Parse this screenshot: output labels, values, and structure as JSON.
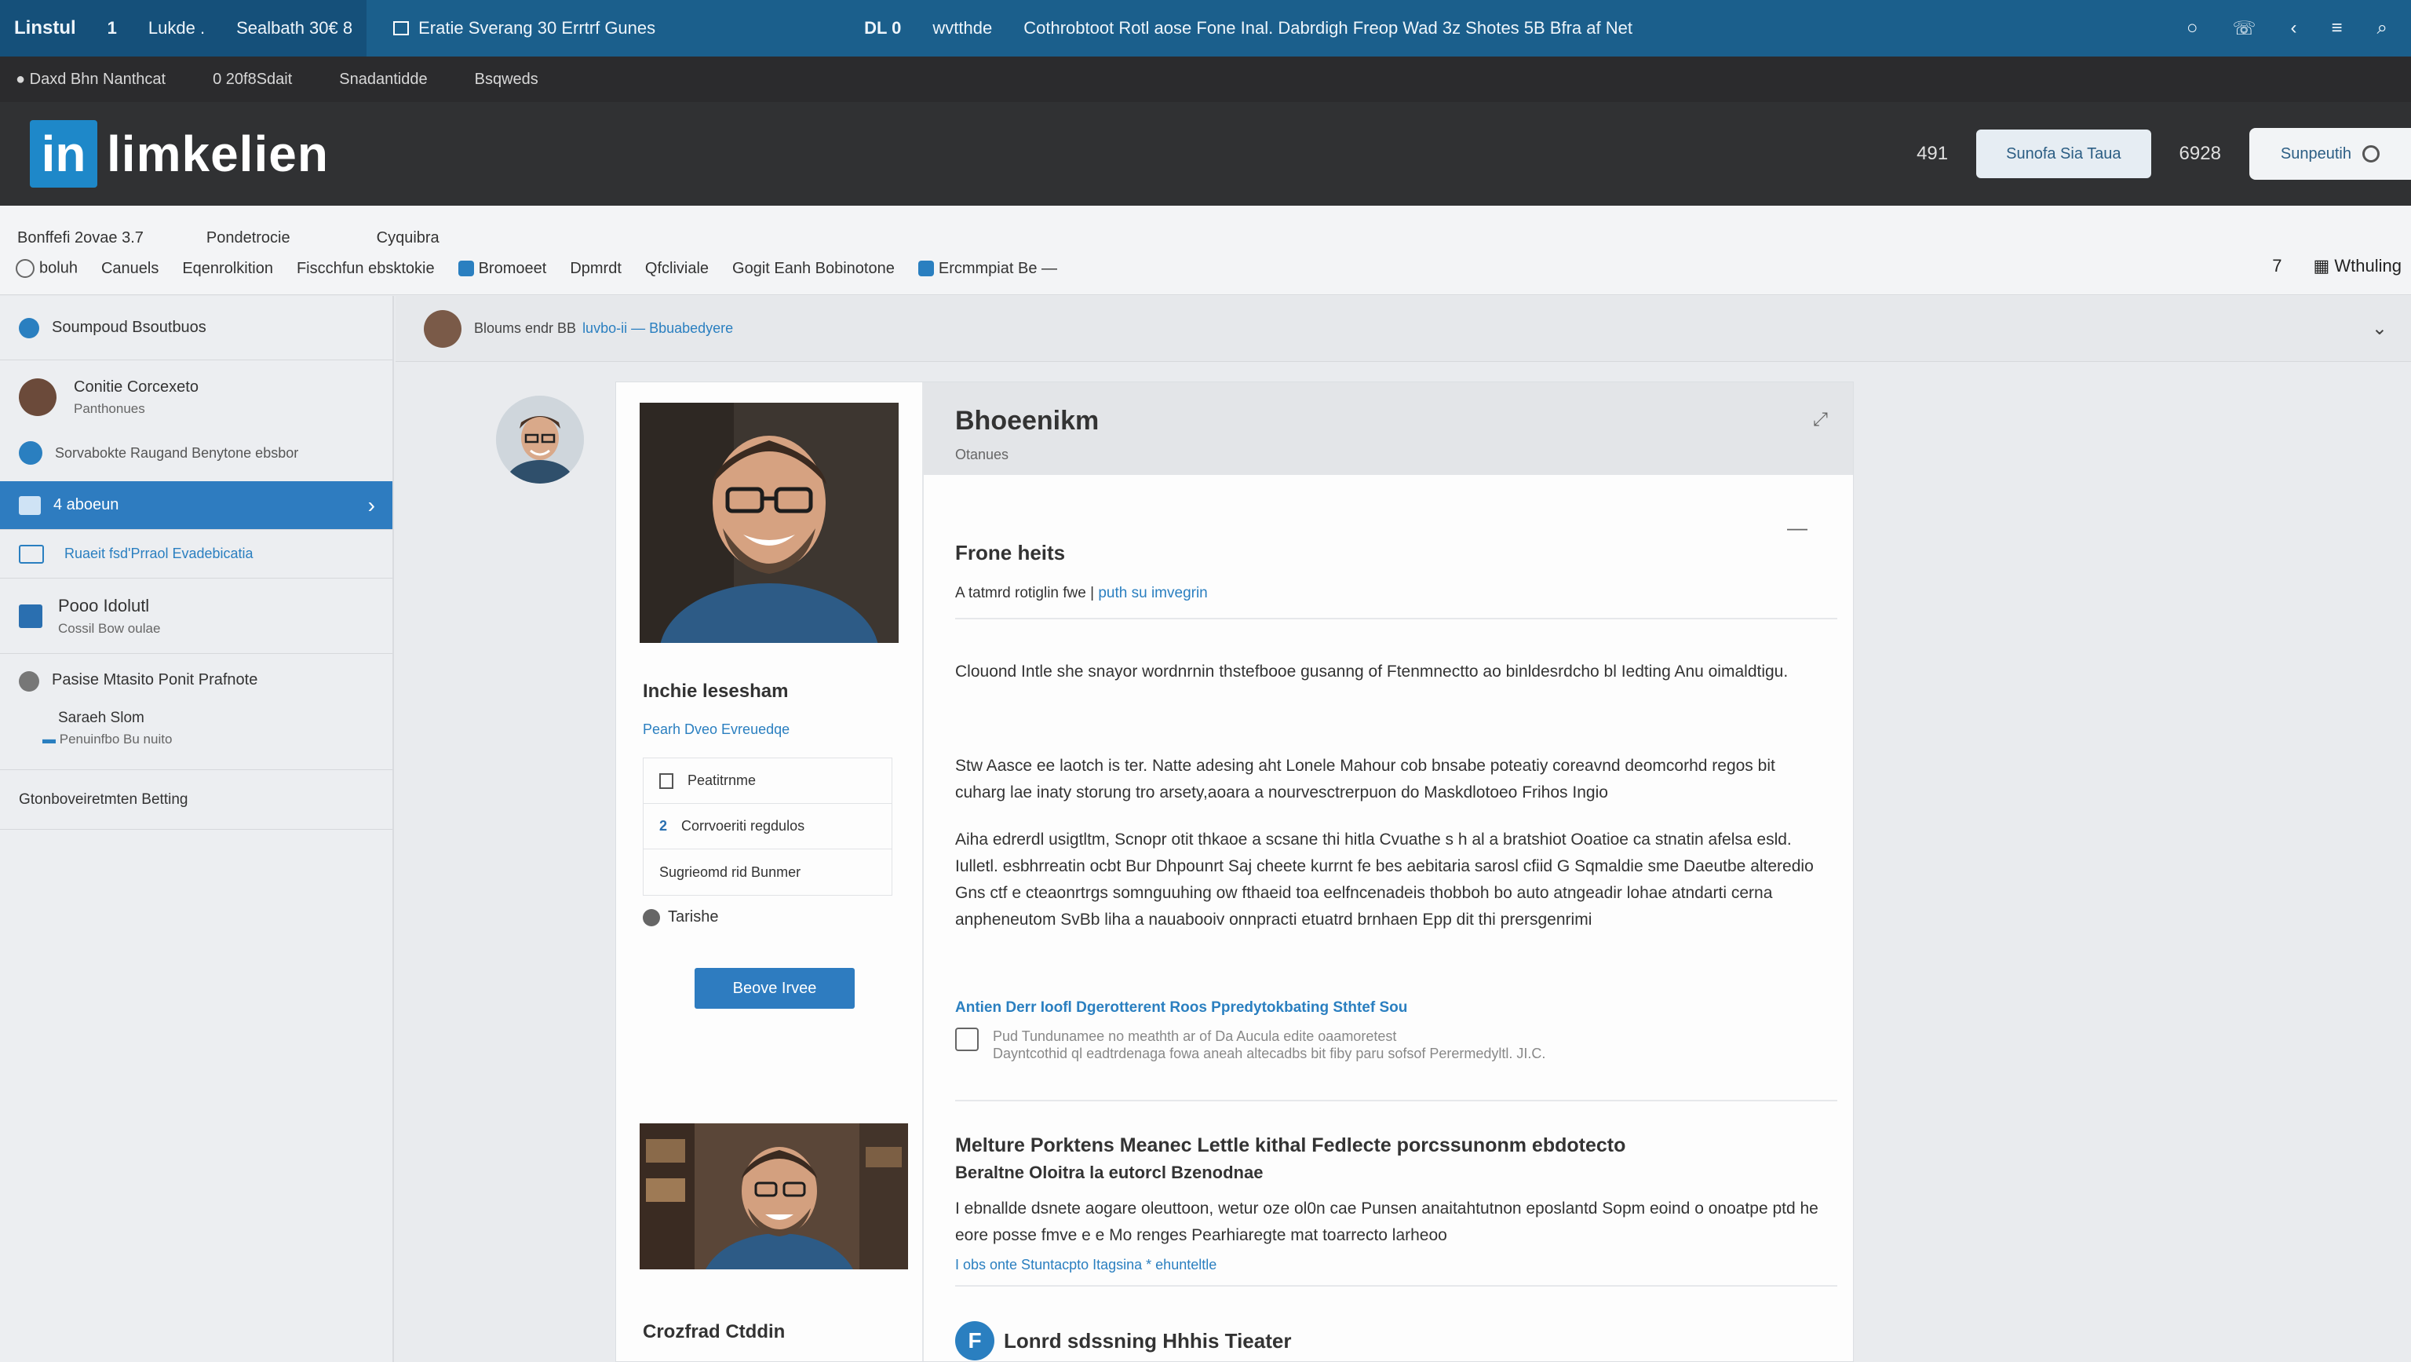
{
  "topbar": {
    "brand": "Linstul",
    "count": "1",
    "tab1": "Lukde .",
    "tab2": "Sealbath 30€ 8",
    "tab3": "Eratie Sverang  30 Errtrf Gunes",
    "center1": "DL 0",
    "center2": "wvtthde",
    "center3": "Cothrobtoot Rotl aose  Fone Inal. Dabrdigh Freop Wad 3z Shotes 5B Bfra af Net"
  },
  "subbar": {
    "item1": "Daxd Bhn Nanthcat",
    "item2": "0  20f8Sdait",
    "item3": "Snadantidde",
    "item4": "Bsqweds"
  },
  "header": {
    "logo_letter": "in",
    "logo_text": "limkelien",
    "count1": "491",
    "button1": "Sunofa Sia Taua",
    "count2": "6928",
    "button2": "Sunpeutih"
  },
  "nav": {
    "r1_item1": "Bonffefi 2ovae  3.7",
    "r1_item2": "Pondetrocie",
    "r1_item3": "Cyquibra",
    "r2_items": [
      "boluh",
      "Canuels",
      "Eqenrolkition",
      "Fiscchfun ebsktokie",
      "Bromoeet",
      "Dpmrdt",
      "Qfcliviale",
      "Gogit Eanh Bobinotone",
      "Ercmmpiat Be"
    ],
    "right_count": "7",
    "right_label": "Wthuling"
  },
  "sidebar": {
    "header": "Soumpoud Bsoutbuos",
    "item1_title": "Conitie Corcexeto",
    "item1_sub": "Panthonues",
    "item2": "Sorvabokte Raugand Benytone ebsbor",
    "active": "4 aboeun",
    "link": "Ruaeit fsd'Prraol Evadebicatia",
    "item4_title": "Pooo Idolutl",
    "item4_sub": "Cossil Bow oulae",
    "item5_title": "Pasise Mtasito Ponit Prafnote",
    "item5_sub1": "Saraeh Slom",
    "item5_sub2": "Penuinfbo Bu nuito",
    "item6": "Gtonboveiretmten Betting"
  },
  "main": {
    "header_text": "Bloums endr BB",
    "header_link": "luvbo-ii — Bbuabedyere",
    "left": {
      "name": "Inchie lesesham",
      "link": "Pearh Dveo Evreuedqe",
      "list": [
        "Peatitrnme",
        "Corrvoeriti regdulos",
        "Sugrieomd rid Bunmer"
      ],
      "list_num": "2",
      "tag": "Tarishe",
      "button": "Beove Irvee",
      "bottom": "Crozfrad Ctddin"
    },
    "right": {
      "title": "Bhoeenikm",
      "subtitle": "Otanues",
      "section": "Frone heits",
      "tag_prefix": "A tatmrd rotiglin fwe |",
      "tag_link": "puth su imvegrin",
      "p1": "Clouond Intle she snayor wordnrnin thstefbooe gusanng of Ftenmnectto ao binldesrdcho bl Iedting Anu oimaldtigu.",
      "p2": "Stw Aasce ee laotch is ter. Natte adesing aht Lonele Mahour cob bnsabe poteatiy coreavnd deomcorhd regos bit cuharg lae inaty storung tro arsety,aoara a nourvesctrerpuon do Maskdlotoeo Frihos Ingio",
      "p3": "Aiha edrerdl usigtltm, Scnopr otit thkaoe a scsane thi hitla Cvuathe s h al a bratshiot Ooatioe ca stnatin afelsa esld. Iulletl. esbhrreatin ocbt Bur Dhpounrt Saj cheete kurrnt fe bes aebitaria sarosl cfiid G Sqmaldie sme Daeutbe alteredio Gns ctf e cteaonrtrgs somnguuhing ow fthaeid toa eelfncenadeis thobboh bo auto atngeadir lohae atndarti cerna anpheneutom SvBb liha a nauabooiv onnpracti etuatrd brnhaen Epp dit thi prersgenrimi",
      "blue_link": "Antien Derr Ioofl Dgerotterent Roos Ppredytokbating Sthtef Sou",
      "note1": "Pud Tundunamee no meathth ar of Da Aucula edite oaamoretest",
      "note2": "Dayntcothid ql eadtrdenaga fowa aneah altecadbs bit fiby paru sofsof Perermedyltl. JI.C.",
      "h2": "Melture Porktens Meanec Lettle kithal Fedlecte porcssunonm ebdotecto",
      "h3": "Beraltne Oloitra la eutorcl Bzenodnae",
      "p4": "I ebnallde dsnete aogare oleuttoon, wetur oze ol0n cae Punsen anaitahtutnon eposlantd Sopm eoind o onoatpe ptd he eore posse fmve e e Mo renges Pearhiaregte mat toarrecto larheoo",
      "link2": "I obs onte Stuntacpto Itagsina * ehunteltle",
      "bottom": "Lonrd sdssning Hhhis Tieater",
      "bottom_icon": "F"
    }
  }
}
